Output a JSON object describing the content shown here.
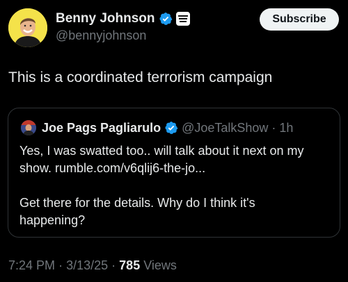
{
  "post": {
    "author": {
      "name": "Benny Johnson",
      "handle": "@bennyjohnson",
      "verified": true,
      "affiliation_badge_icon": "organization-badge-icon",
      "avatar_bg": "#f4e24a"
    },
    "subscribe_label": "Subscribe",
    "text": "This is a coordinated terrorism campaign",
    "quote": {
      "author_name": "Joe Pags Pagliarulo",
      "verified": true,
      "handle": "@JoeTalkShow",
      "separator": "·",
      "time": "1h",
      "lines": [
        "Yes, I was swatted too.. will talk about it next on my",
        "show.  rumble.com/v6qlij6-the-jo...",
        "",
        "Get there for the details.  Why do I think it's",
        "happening?"
      ]
    },
    "meta": {
      "time": "7:24 PM",
      "sep1": "·",
      "date": "3/13/25",
      "sep2": "·",
      "views_count": "785",
      "views_label": "Views"
    }
  },
  "colors": {
    "background": "#000000",
    "text_primary": "#e7e9ea",
    "text_secondary": "#71767b",
    "verified_blue": "#1d9bf0",
    "border": "#2f3336",
    "button_bg": "#eff3f4"
  }
}
